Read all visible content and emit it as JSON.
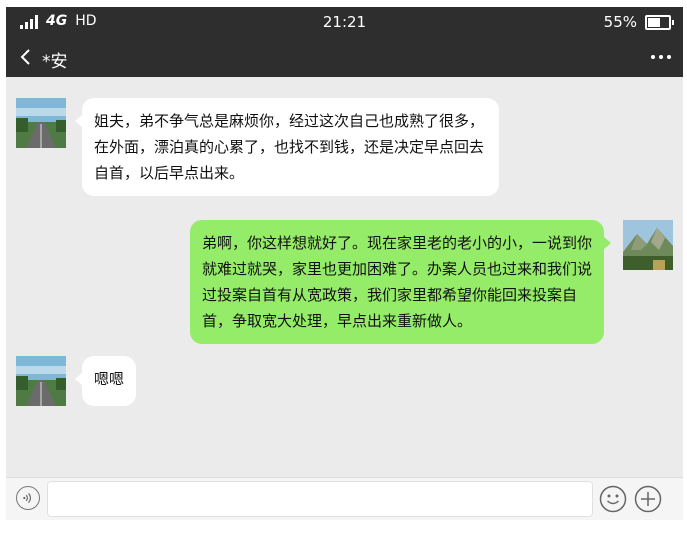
{
  "status_bar": {
    "network": "4G",
    "hd": "HD",
    "time": "21:21",
    "battery": "55%"
  },
  "header": {
    "back_icon": "chevron-left-icon",
    "title": "*安",
    "more_icon": "more-dots-icon"
  },
  "messages": [
    {
      "side": "left",
      "avatar": "landscape-road-avatar",
      "text": "姐夫，弟不争气总是麻烦你，经过这次自己也成熟了很多，在外面，漂泊真的心累了，也找不到钱，还是决定早点回去自首，以后早点出来。"
    },
    {
      "side": "right",
      "avatar": "mountain-landscape-avatar",
      "text": "弟啊，你这样想就好了。现在家里老的老小的小，一说到你就难过就哭，家里也更加困难了。办案人员也过来和我们说过投案自首有从宽政策，我们家里都希望你能回来投案自首，争取宽大处理，早点出来重新做人。"
    },
    {
      "side": "left",
      "avatar": "landscape-road-avatar",
      "text": "嗯嗯"
    }
  ],
  "input_bar": {
    "voice_icon": "voice-icon",
    "text_value": "",
    "emoji_icon": "emoji-icon",
    "plus_icon": "plus-icon"
  },
  "colors": {
    "bar_dark": "#2e2e2e",
    "chat_bg": "#ebebeb",
    "bubble_left": "#ffffff",
    "bubble_right": "#95ec69"
  }
}
